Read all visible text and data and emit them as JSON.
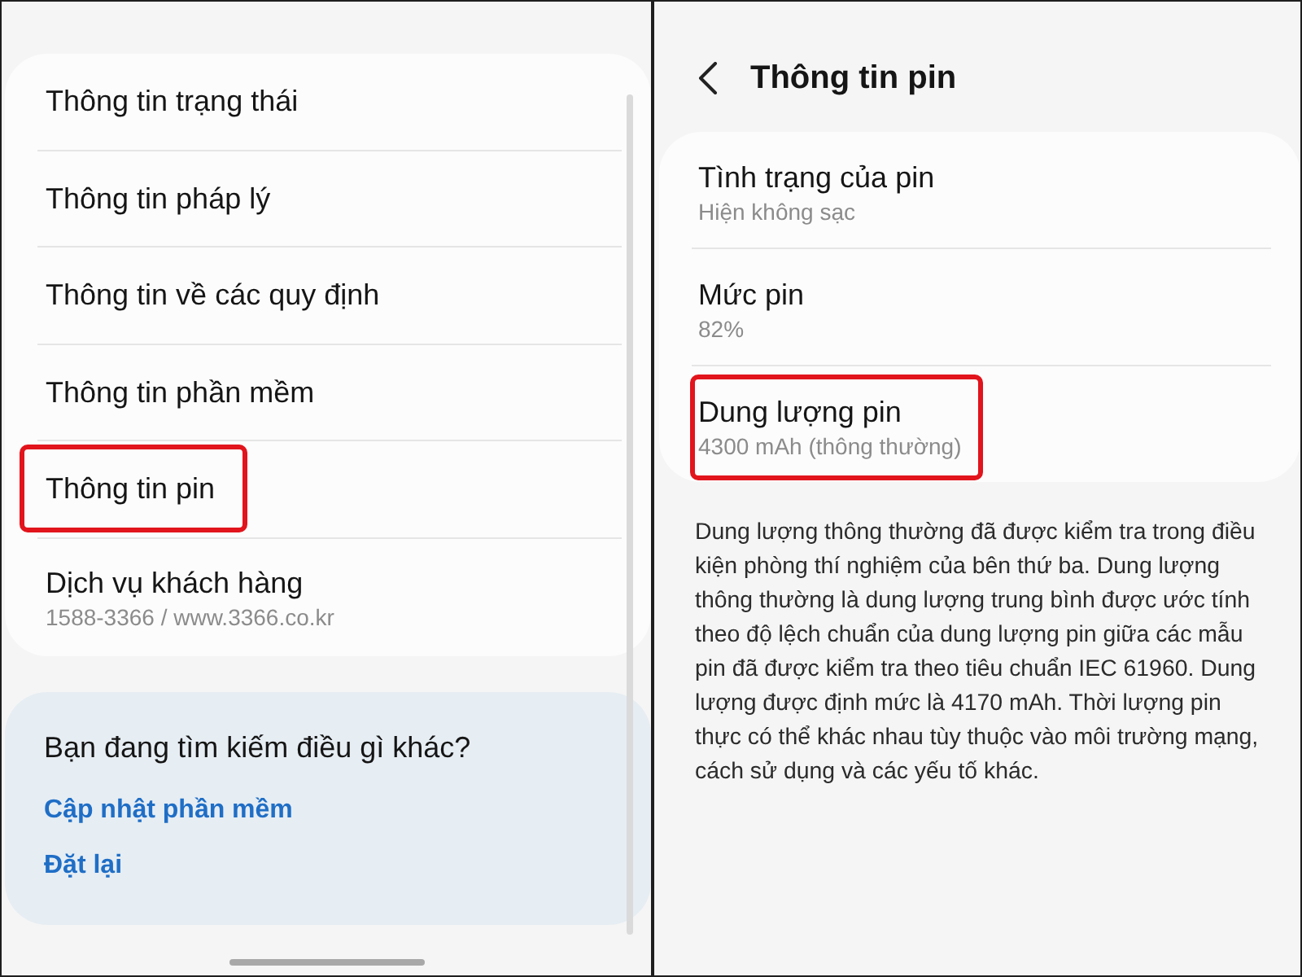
{
  "left_screen": {
    "menu_items": [
      {
        "title": "Thông tin trạng thái",
        "highlighted": false
      },
      {
        "title": "Thông tin pháp lý",
        "highlighted": false
      },
      {
        "title": "Thông tin về các quy định",
        "highlighted": false
      },
      {
        "title": "Thông tin phần mềm",
        "highlighted": false
      },
      {
        "title": "Thông tin pin",
        "highlighted": true
      },
      {
        "title": "Dịch vụ khách hàng",
        "subtitle": "1588-3366 / www.3366.co.kr",
        "highlighted": false
      }
    ],
    "suggestions": {
      "heading": "Bạn đang tìm kiếm điều gì khác?",
      "links": [
        "Cập nhật phần mềm",
        "Đặt lại"
      ]
    }
  },
  "right_screen": {
    "header": {
      "title": "Thông tin pin"
    },
    "info_items": [
      {
        "title": "Tình trạng của pin",
        "subtitle": "Hiện không sạc",
        "highlighted": false
      },
      {
        "title": "Mức pin",
        "subtitle": "82%",
        "highlighted": false
      },
      {
        "title": "Dung lượng pin",
        "subtitle": "4300 mAh (thông thường)",
        "highlighted": true
      }
    ],
    "description": "Dung lượng thông thường đã được kiểm tra trong điều kiện phòng thí nghiệm của bên thứ ba. Dung lượng thông thường là dung lượng trung bình được ước tính theo độ lệch chuẩn của dung lượng pin giữa các mẫu pin đã được kiểm tra theo tiêu chuẩn IEC 61960. Dung lượng được định mức là 4170 mAh. Thời lượng pin thực có thể khác nhau tùy thuộc vào môi trường mạng, cách sử dụng và các yếu tố khác."
  }
}
